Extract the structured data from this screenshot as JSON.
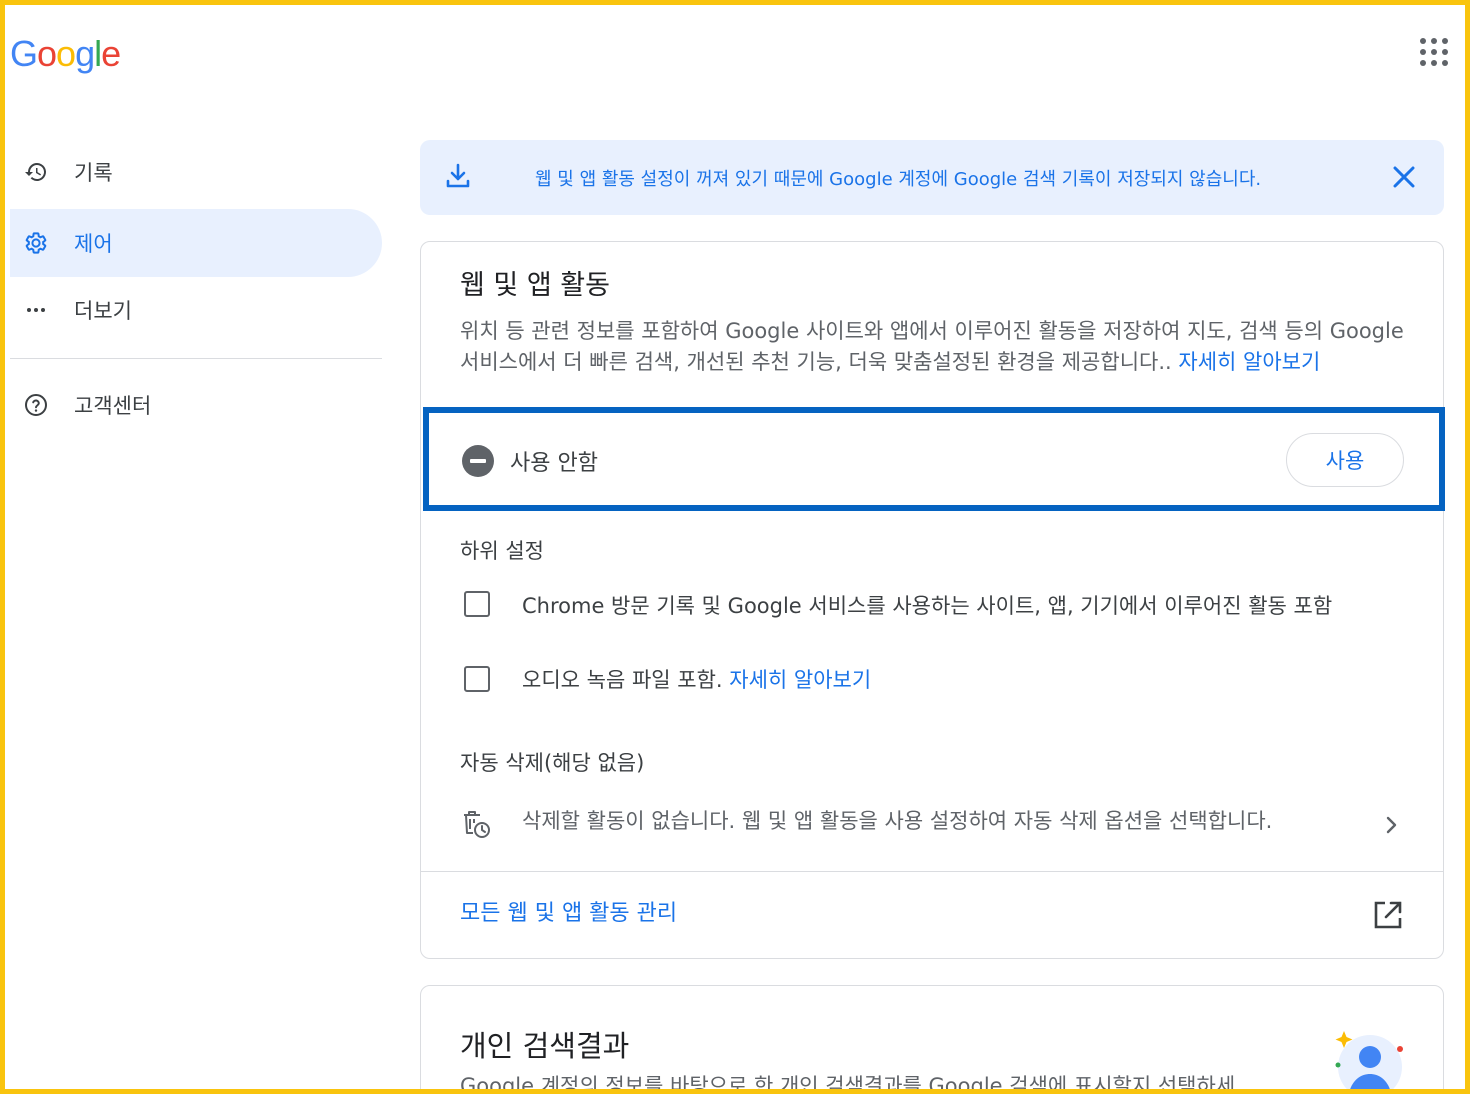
{
  "header": {
    "logo_letters": [
      {
        "ch": "G",
        "color": "#4285f4"
      },
      {
        "ch": "o",
        "color": "#ea4335"
      },
      {
        "ch": "o",
        "color": "#fbbc05"
      },
      {
        "ch": "g",
        "color": "#4285f4"
      },
      {
        "ch": "l",
        "color": "#34a853"
      },
      {
        "ch": "e",
        "color": "#ea4335"
      }
    ],
    "apps_icon": "apps-grid-icon"
  },
  "sidebar": {
    "items": [
      {
        "label": "기록",
        "icon": "history-icon",
        "active": false
      },
      {
        "label": "제어",
        "icon": "gear-icon",
        "active": true
      },
      {
        "label": "더보기",
        "icon": "more-horiz-icon",
        "active": false
      },
      {
        "label": "고객센터",
        "icon": "help-icon",
        "active": false
      }
    ]
  },
  "banner": {
    "message": "웹 및 앱 활동 설정이 꺼져 있기 때문에 Google 계정에 Google 검색 기록이 저장되지 않습니다.",
    "icon": "download-icon",
    "close_icon": "close-icon"
  },
  "activity_card": {
    "title": "웹 및 앱 활동",
    "description": "위치 등 관련 정보를 포함하여 Google 사이트와 앱에서 이루어진 활동을 저장하여 지도, 검색 등의 Google 서비스에서 더 빠른 검색, 개선된 추천 기능, 더욱 맞춤설정된 환경을 제공합니다.. ",
    "learn_more": "자세히 알아보기",
    "status": "사용 안함",
    "enable_button": "사용",
    "sub_settings_title": "하위 설정",
    "checkboxes": [
      {
        "label": "Chrome 방문 기록 및 Google 서비스를 사용하는 사이트, 앱, 기기에서 이루어진 활동 포함",
        "checked": false
      },
      {
        "label": "오디오 녹음 파일 포함. ",
        "link": "자세히 알아보기",
        "checked": false
      }
    ],
    "auto_delete_title": "자동 삭제(해당 없음)",
    "auto_delete_text": "삭제할 활동이 없습니다. 웹 및 앱 활동을 사용 설정하여 자동 삭제 옵션을 선택합니다.",
    "manage_link": "모든 웹 및 앱 활동 관리"
  },
  "personal_card": {
    "title": "개인 검색결과",
    "description": "Google 계정의 정보를 바탕으로 한 개인 검색결과를 Google 검색에 표시할지 선택하세"
  },
  "colors": {
    "accent": "#1a73e8",
    "highlight_border": "#0563c1",
    "frame": "#f9c40e",
    "active_bg": "#e8f0fe"
  }
}
